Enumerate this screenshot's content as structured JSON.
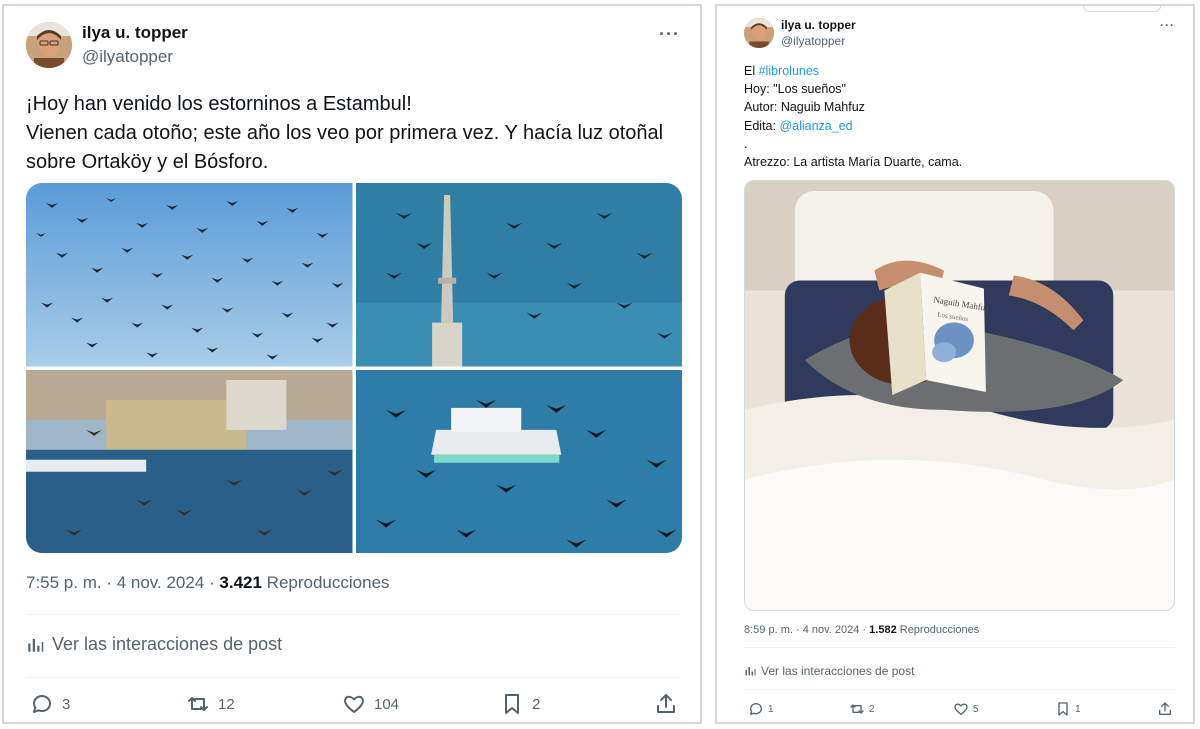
{
  "left": {
    "author": {
      "name": "ilya u. topper",
      "handle": "@ilyatopper"
    },
    "more_label": "···",
    "text_lines": [
      "¡Hoy han venido los estorninos a Estambul!",
      "Vienen cada otoño; este año los veo por primera vez. Y hacía luz otoñal sobre Ortaköy y el Bósforo."
    ],
    "time": "7:55 p. m. · 4 nov. 2024 · ",
    "views": "3.421",
    "views_label": " Reproducciones",
    "insights": "Ver las interacciones de post",
    "replies": "3",
    "reposts": "12",
    "likes": "104",
    "bookmarks": "2"
  },
  "right": {
    "author": {
      "name": "ilya u. topper",
      "handle": "@ilyatopper"
    },
    "more_label": "···",
    "line1_prefix": "El ",
    "hashtag": "#librolunes",
    "line2": "Hoy: \"Los sueños\"",
    "line3": "Autor: Naguib Mahfuz",
    "line4_prefix": "Edita: ",
    "mention": "@alianza_ed",
    "line5": ".",
    "line6": "Atrezzo: La artista María Duarte, cama.",
    "book_author": "Naguib Mahfuz",
    "book_title": "Los sueños",
    "time": "8:59 p. m. · 4 nov. 2024 · ",
    "views": "1.582",
    "views_label": " Reproducciones",
    "insights": "Ver las interacciones de post",
    "replies": "1",
    "reposts": "2",
    "likes": "5",
    "bookmarks": "1"
  },
  "colors": {
    "accent": "#1d9bf0",
    "muted": "#536471",
    "highlight": "#ff0000"
  },
  "icons": [
    "reply-icon",
    "repost-icon",
    "like-icon",
    "bookmark-icon",
    "share-icon",
    "analytics-icon",
    "more-icon"
  ]
}
